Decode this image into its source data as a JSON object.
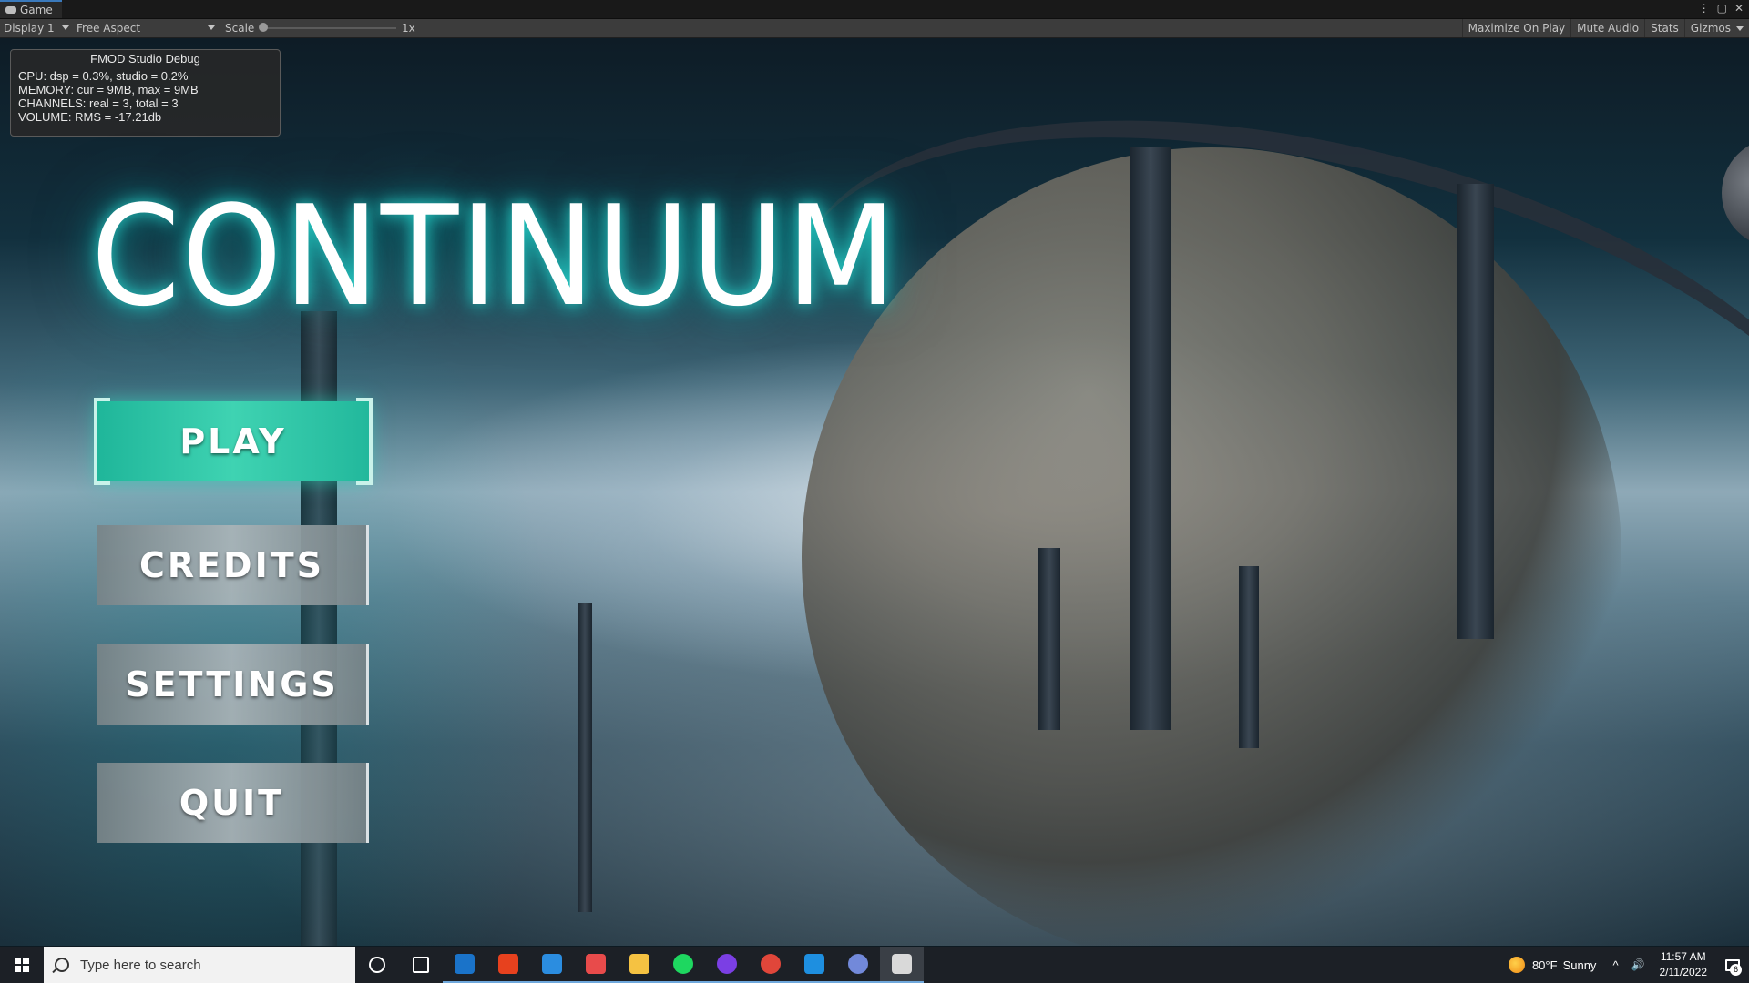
{
  "editor": {
    "tab_label": "Game",
    "tab_menu_glyph": "⋮",
    "tab_maximize_glyph": "▢",
    "tab_close_glyph": "✕",
    "display": "Display 1",
    "aspect": "Free Aspect",
    "scale_label": "Scale",
    "scale_value": "1x",
    "scale_level": 0.0,
    "toggles": [
      "Maximize On Play",
      "Mute Audio",
      "Stats",
      "Gizmos"
    ]
  },
  "fmod": {
    "title": "FMOD Studio Debug",
    "lines": [
      "CPU: dsp = 0.3%, studio = 0.2%",
      "MEMORY: cur = 9MB, max = 9MB",
      "CHANNELS: real = 3, total = 3",
      "VOLUME: RMS = -17.21db"
    ]
  },
  "game": {
    "title": "CONTINUUM",
    "menu": [
      {
        "label": "PLAY",
        "active": true
      },
      {
        "label": "CREDITS",
        "active": false
      },
      {
        "label": "SETTINGS",
        "active": false
      },
      {
        "label": "QUIT",
        "active": false
      }
    ],
    "accent": "#2cc8a8",
    "glow": "#28dcd2"
  },
  "taskbar": {
    "search_placeholder": "Type here to search",
    "apps": [
      {
        "name": "cortana-icon",
        "color": "#ffffff"
      },
      {
        "name": "task-view-icon",
        "color": "#ffffff"
      },
      {
        "name": "mail-icon",
        "color": "#1a73c9"
      },
      {
        "name": "office-icon",
        "color": "#e7411e"
      },
      {
        "name": "store-icon",
        "color": "#2b8de0"
      },
      {
        "name": "paint-icon",
        "color": "#e84b4b"
      },
      {
        "name": "file-explorer-icon",
        "color": "#f5c242"
      },
      {
        "name": "spotify-icon",
        "color": "#1ed760"
      },
      {
        "name": "github-desktop-icon",
        "color": "#7b3fe4"
      },
      {
        "name": "chrome-icon",
        "color": "#e0463a"
      },
      {
        "name": "vscode-icon",
        "color": "#1e8fe0"
      },
      {
        "name": "discord-icon",
        "color": "#7289da"
      },
      {
        "name": "unity-icon",
        "color": "#d9d9d9"
      }
    ],
    "weather": {
      "temp": "80°F",
      "condition": "Sunny"
    },
    "tray_chevron": "^",
    "volume_glyph": "🔊",
    "time": "11:57 AM",
    "date": "2/11/2022",
    "notification_count": "6"
  }
}
